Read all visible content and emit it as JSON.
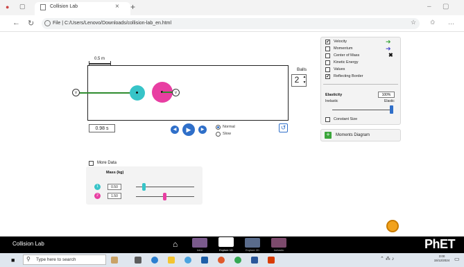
{
  "browser": {
    "tab_title": "Collision Lab",
    "url": "File | C:/Users/Lenovo/Downloads/collision-lab_en.html"
  },
  "sim": {
    "scale_label": "0.5 m",
    "time_value": "0.98 s",
    "speed_options": [
      "Normal",
      "Slow"
    ],
    "speed_selected": "Normal",
    "balls_label": "Balls",
    "balls_value": "2"
  },
  "options_panel": {
    "items": [
      {
        "label": "Velocity",
        "checked": true
      },
      {
        "label": "Momentum",
        "checked": false
      },
      {
        "label": "Center of Mass",
        "checked": false
      },
      {
        "label": "Kinetic Energy",
        "checked": false
      },
      {
        "label": "Values",
        "checked": false
      },
      {
        "label": "Reflecting Border",
        "checked": true
      }
    ],
    "elasticity_title": "Elasticity",
    "elasticity_value": "100%",
    "elasticity_min_label": "Inelastic",
    "elasticity_max_label": "Elastic",
    "elasticity_level": 1.0,
    "constant_size_label": "Constant Size",
    "constant_size_checked": false
  },
  "moments_diagram_label": "Moments Diagram",
  "more_data": {
    "label": "More Data",
    "checked": false,
    "mass_title": "Mass (kg)",
    "balls": [
      {
        "icon_label": "1",
        "value": "0.50",
        "color": "#37c4c8",
        "slider_fraction": 0.18
      },
      {
        "icon_label": "2",
        "value": "1.50",
        "color": "#e83ea2",
        "slider_fraction": 0.5
      }
    ]
  },
  "navbar": {
    "title": "Collision Lab",
    "screens": [
      "Intro",
      "Explore 1D",
      "Explore 2D",
      "Inelastic"
    ],
    "selected_screen": "Explore 1D",
    "logo": "PhET"
  },
  "taskbar": {
    "search_placeholder": "Type here to search",
    "time": "3:00",
    "date": "15/12/2024"
  },
  "colors": {
    "velocity_arrow": "#3aa53a",
    "momentum_arrow": "#4444cc",
    "ball1": "#37c4c8",
    "ball2": "#e83ea2",
    "accent": "#2f6fc9"
  }
}
